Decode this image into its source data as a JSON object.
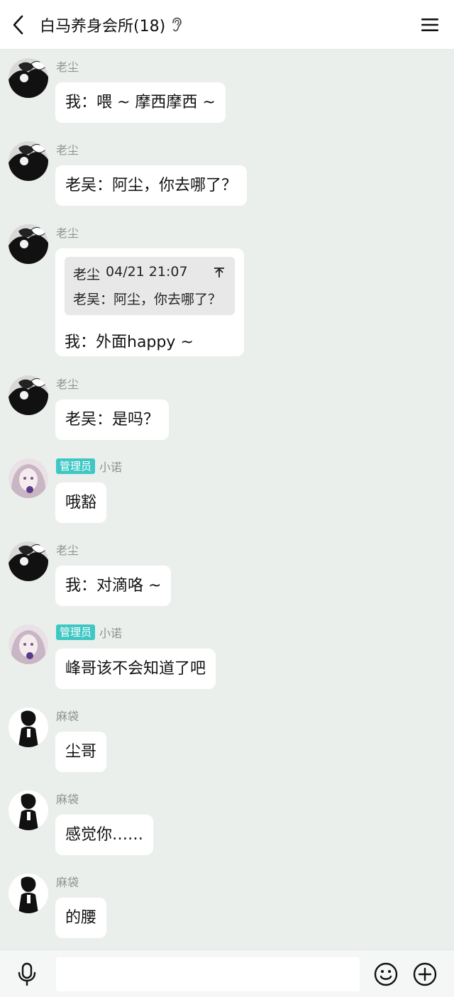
{
  "header": {
    "title": "白马养身会所(18)"
  },
  "messages": [
    {
      "sender": "老尘",
      "avatar": "avatar-laochen",
      "text": "我：喂 ~ 摩西摩西 ~"
    },
    {
      "sender": "老尘",
      "avatar": "avatar-laochen",
      "text": "老吴：阿尘，你去哪了？"
    },
    {
      "sender": "老尘",
      "avatar": "avatar-laochen",
      "quote": {
        "author": "老尘",
        "time": "04/21 21:07",
        "text": "老吴：阿尘，你去哪了？"
      },
      "text": "我：外面happy ~"
    },
    {
      "sender": "老尘",
      "avatar": "avatar-laochen",
      "text": "老吴：是吗？"
    },
    {
      "sender": "小诺",
      "badge": "管理员",
      "avatar": "avatar-xiaonuo",
      "text": "哦豁"
    },
    {
      "sender": "老尘",
      "avatar": "avatar-laochen",
      "text": "我：对滴咯 ~"
    },
    {
      "sender": "小诺",
      "badge": "管理员",
      "avatar": "avatar-xiaonuo",
      "text": "峰哥该不会知道了吧"
    },
    {
      "sender": "麻袋",
      "avatar": "avatar-madai",
      "text": "尘哥"
    },
    {
      "sender": "麻袋",
      "avatar": "avatar-madai",
      "text": "感觉你……"
    },
    {
      "sender": "麻袋",
      "avatar": "avatar-madai",
      "text": "的腰"
    }
  ],
  "input": {
    "placeholder": ""
  },
  "colors": {
    "chat_bg": "#ebefec",
    "badge": "#3ec7c3",
    "bubble": "#ffffff"
  },
  "icons": [
    "back-arrow-icon",
    "ear-icon",
    "menu-icon",
    "microphone-icon",
    "emoji-icon",
    "plus-icon",
    "quote-arrow-icon"
  ]
}
